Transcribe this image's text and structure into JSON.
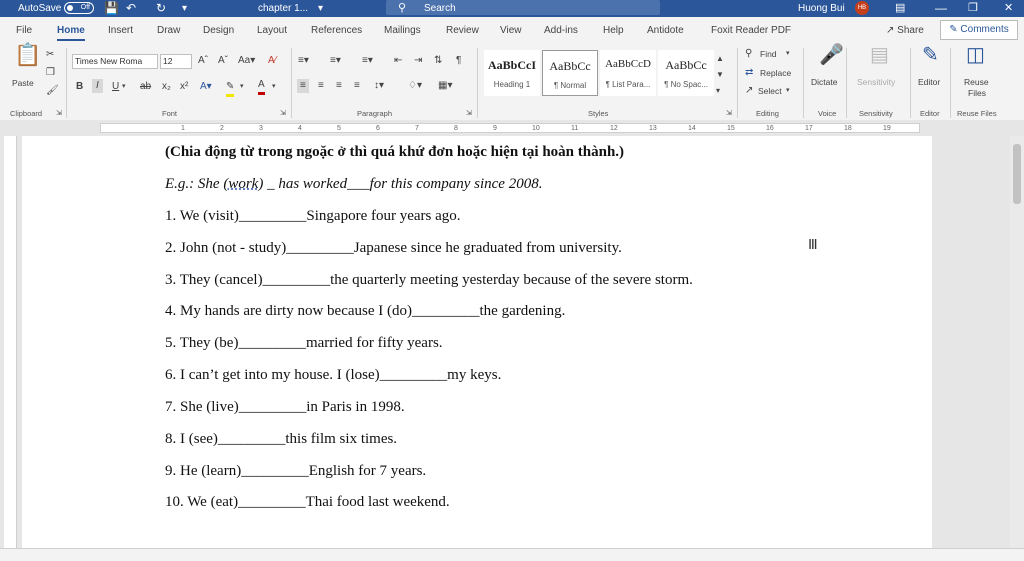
{
  "titlebar": {
    "autosave_label": "AutoSave",
    "autosave_state": "Off",
    "doc_name": "chapter 1...",
    "search_placeholder": "Search",
    "user_name": "Huong Bui",
    "user_initials": "HB"
  },
  "tabs": [
    "File",
    "Home",
    "Insert",
    "Draw",
    "Design",
    "Layout",
    "References",
    "Mailings",
    "Review",
    "View",
    "Add-ins",
    "Help",
    "Antidote",
    "Foxit Reader PDF"
  ],
  "active_tab": "Home",
  "share_label": "Share",
  "comments_label": "Comments",
  "ribbon": {
    "clipboard": {
      "paste": "Paste",
      "label": "Clipboard"
    },
    "font": {
      "name": "Times New Roma",
      "size": "12",
      "label": "Font"
    },
    "paragraph": {
      "label": "Paragraph"
    },
    "styles": {
      "label": "Styles",
      "items": [
        {
          "preview": "AaBbCcI",
          "name": "Heading 1"
        },
        {
          "preview": "AaBbCc",
          "name": "¶ Normal"
        },
        {
          "preview": "AaBbCcD",
          "name": "¶ List Para..."
        },
        {
          "preview": "AaBbCc",
          "name": "¶ No Spac..."
        }
      ]
    },
    "editing": {
      "find": "Find",
      "replace": "Replace",
      "select": "Select",
      "label": "Editing"
    },
    "voice": {
      "dictate": "Dictate",
      "label": "Voice"
    },
    "sensitivity": {
      "btn": "Sensitivity",
      "label": "Sensitivity"
    },
    "editor": {
      "btn": "Editor",
      "label": "Editor"
    },
    "reuse": {
      "btn1": "Reuse",
      "btn2": "Files",
      "label": "Reuse Files"
    }
  },
  "ruler_numbers": [
    "1",
    "2",
    "3",
    "4",
    "5",
    "6",
    "7",
    "8",
    "9",
    "10",
    "11",
    "12",
    "13",
    "14",
    "15",
    "16",
    "17",
    "18",
    "19"
  ],
  "document": {
    "heading": "(Chia động từ trong ngoặc ở thì quá khứ đơn hoặc hiện tại hoàn thành.)",
    "example_prefix": "E.g.: She ",
    "example_work": "(work)",
    "example_rest": " _ has worked___for this company since 2008.",
    "items": [
      "1. We (visit)_________Singapore four years ago.",
      "2. John (not - study)_________Japanese since he graduated from university.",
      "3. They (cancel)_________the quarterly meeting yesterday because of the severe storm.",
      "4. My hands are dirty now because I (do)_________the gardening.",
      "5. They (be)_________married for fifty years.",
      "6. I can’t get into my house. I (lose)_________my keys.",
      "7. She (live)_________in Paris in 1998.",
      "8. I (see)_________this film six times.",
      "9. He (learn)_________English for 7 years.",
      "10. We (eat)_________Thai food last weekend."
    ]
  },
  "colors": {
    "word_blue": "#2b579a",
    "ribbon_bg": "#f3f3f3"
  }
}
